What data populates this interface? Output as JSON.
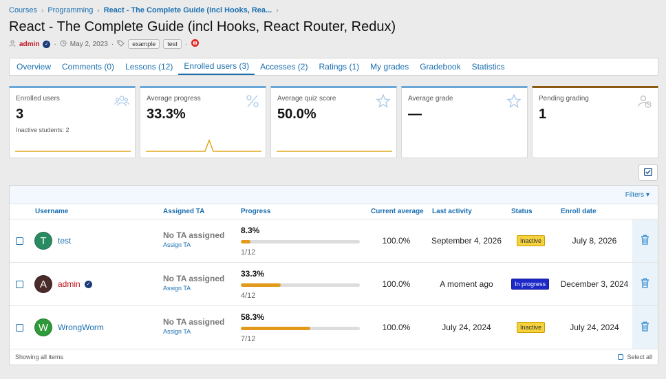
{
  "breadcrumb": {
    "items": [
      "Courses",
      "Programming",
      "React - The Complete Guide (incl Hooks, Rea..."
    ]
  },
  "page_title": "React - The Complete Guide (incl Hooks, React Router, Redux)",
  "meta": {
    "author": "admin",
    "date": "May 2, 2023",
    "tags": [
      "example",
      "test"
    ]
  },
  "tabs": [
    {
      "label": "Overview",
      "active": false
    },
    {
      "label": "Comments (0)",
      "active": false
    },
    {
      "label": "Lessons (12)",
      "active": false
    },
    {
      "label": "Enrolled users (3)",
      "active": true
    },
    {
      "label": "Accesses (2)",
      "active": false
    },
    {
      "label": "Ratings (1)",
      "active": false
    },
    {
      "label": "My grades",
      "active": false
    },
    {
      "label": "Gradebook",
      "active": false
    },
    {
      "label": "Statistics",
      "active": false
    }
  ],
  "cards": [
    {
      "label": "Enrolled users",
      "value": "3",
      "sub": "Inactive students: 2",
      "icon": "users-icon",
      "spark": "flat"
    },
    {
      "label": "Average progress",
      "value": "33.3%",
      "sub": "",
      "icon": "percent-icon",
      "spark": "spike"
    },
    {
      "label": "Average quiz score",
      "value": "50.0%",
      "sub": "",
      "icon": "star-icon",
      "spark": "flat"
    },
    {
      "label": "Average grade",
      "value": "—",
      "sub": "",
      "icon": "star-icon",
      "spark": "none"
    },
    {
      "label": "Pending grading",
      "value": "1",
      "sub": "",
      "icon": "user-clock-icon",
      "spark": "none"
    }
  ],
  "filters_label": "Filters",
  "table": {
    "headers": {
      "username": "Username",
      "ta": "Assigned TA",
      "progress": "Progress",
      "average": "Current average",
      "activity": "Last activity",
      "status": "Status",
      "enroll": "Enroll date"
    },
    "rows": [
      {
        "avatar_letter": "T",
        "avatar_color": "#2a8a62",
        "username": "test",
        "verified": false,
        "is_admin": false,
        "ta": "No TA assigned",
        "ta_link": "Assign TA",
        "progress_pct": "8.3%",
        "progress_fraction": 0.083,
        "progress_frac": "1/12",
        "average": "100.0%",
        "last_activity": "September 4, 2026",
        "status": "Inactive",
        "status_kind": "inactive",
        "enroll_date": "July 8, 2026"
      },
      {
        "avatar_letter": "A",
        "avatar_color": "#4a2b2b",
        "username": "admin",
        "verified": true,
        "is_admin": true,
        "ta": "No TA assigned",
        "ta_link": "Assign TA",
        "progress_pct": "33.3%",
        "progress_fraction": 0.333,
        "progress_frac": "4/12",
        "average": "100.0%",
        "last_activity": "A moment ago",
        "status": "In progress",
        "status_kind": "progress",
        "enroll_date": "December 3, 2024"
      },
      {
        "avatar_letter": "W",
        "avatar_color": "#2f9a3a",
        "username": "WrongWorm",
        "verified": false,
        "is_admin": false,
        "ta": "No TA assigned",
        "ta_link": "Assign TA",
        "progress_pct": "58.3%",
        "progress_fraction": 0.583,
        "progress_frac": "7/12",
        "average": "100.0%",
        "last_activity": "July 24, 2024",
        "status": "Inactive",
        "status_kind": "inactive",
        "enroll_date": "July 24, 2024"
      }
    ]
  },
  "footer": {
    "showing": "Showing all items",
    "select_all": "Select all"
  },
  "colors": {
    "link": "#1a6fb0",
    "admin": "#c0141c",
    "progress_bar": "#e29a1c",
    "inactive_badge": "#f6d23c",
    "in_progress_badge": "#1d28c8",
    "spark": "#e0a91a"
  }
}
